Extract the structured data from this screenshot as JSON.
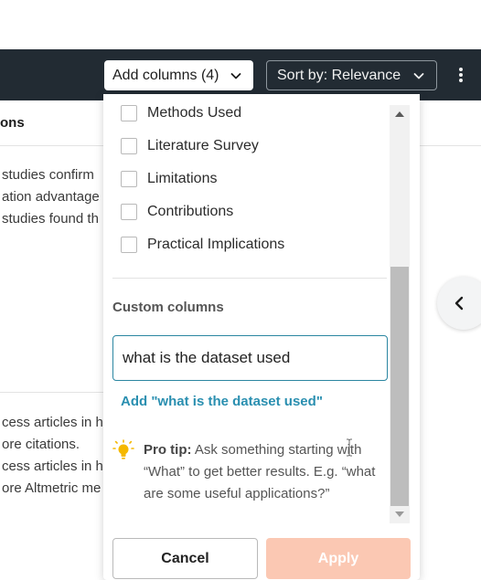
{
  "toolbar": {
    "add_columns_label": "Add columns (4)",
    "sort_label": "Sort by: Relevance",
    "more_icon": "kebab-menu-icon"
  },
  "background": {
    "column_header": "ons",
    "cell1_lines": [
      "studies confirm",
      "ation advantage",
      "studies found th"
    ],
    "cell2_lines": [
      "cess articles in h",
      "ore citations.",
      "cess articles in h",
      "ore Altmetric me"
    ]
  },
  "dropdown": {
    "options": [
      {
        "label": "Methods Used",
        "checked": false
      },
      {
        "label": "Literature Survey",
        "checked": false
      },
      {
        "label": "Limitations",
        "checked": false
      },
      {
        "label": "Contributions",
        "checked": false
      },
      {
        "label": "Practical Implications",
        "checked": false
      }
    ],
    "custom_title": "Custom columns",
    "custom_input_value": "what is the dataset used",
    "add_link": "Add \"what is the dataset used\"",
    "tip_label": "Pro tip:",
    "tip_text": " Ask something starting with “What” to get better results. E.g. “what are some useful applications?”",
    "cancel_label": "Cancel",
    "apply_label": "Apply"
  },
  "colors": {
    "toolbar_bg": "#222b33",
    "accent_link": "#2a8fb0",
    "input_border": "#2b86a1",
    "apply_disabled": "#fbc8b3",
    "tip_bulb": "#f5b800"
  }
}
